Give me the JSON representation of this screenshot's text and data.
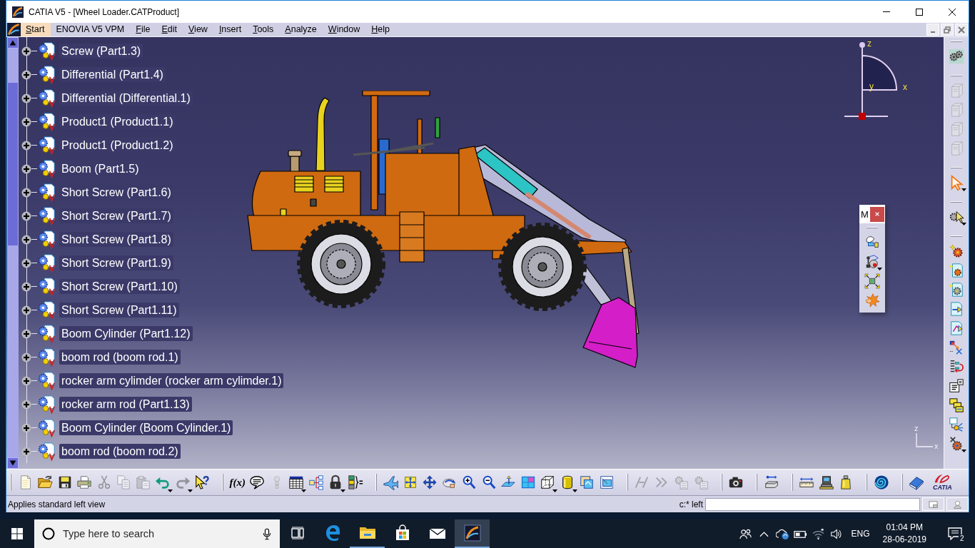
{
  "window": {
    "title": "CATIA V5 - [Wheel Loader.CATProduct]"
  },
  "menu_bar": {
    "items": [
      {
        "label": "Start",
        "highlighted": true,
        "mnemonic": true
      },
      {
        "label": "ENOVIA V5 VPM",
        "highlighted": false,
        "mnemonic": false
      },
      {
        "label": "File",
        "highlighted": false,
        "mnemonic": true
      },
      {
        "label": "Edit",
        "highlighted": false,
        "mnemonic": true
      },
      {
        "label": "View",
        "highlighted": false,
        "mnemonic": true
      },
      {
        "label": "Insert",
        "highlighted": false,
        "mnemonic": true
      },
      {
        "label": "Tools",
        "highlighted": false,
        "mnemonic": true
      },
      {
        "label": "Analyze",
        "highlighted": false,
        "mnemonic": true
      },
      {
        "label": "Window",
        "highlighted": false,
        "mnemonic": true
      },
      {
        "label": "Help",
        "highlighted": false,
        "mnemonic": true
      }
    ]
  },
  "tree": {
    "items": [
      {
        "label": "Screw (Part1.3)",
        "expanded": false
      },
      {
        "label": "Differential (Part1.4)",
        "expanded": false
      },
      {
        "label": "Differential (Differential.1)",
        "expanded": false
      },
      {
        "label": "Product1 (Product1.1)",
        "expanded": false
      },
      {
        "label": "Product1 (Product1.2)",
        "expanded": false
      },
      {
        "label": "Boom (Part1.5)",
        "expanded": false
      },
      {
        "label": "Short Screw (Part1.6)",
        "expanded": false
      },
      {
        "label": "Short Screw (Part1.7)",
        "expanded": false
      },
      {
        "label": "Short Screw (Part1.8)",
        "expanded": false
      },
      {
        "label": "Short Screw (Part1.9)",
        "expanded": false
      },
      {
        "label": "Short Screw (Part1.10)",
        "expanded": false
      },
      {
        "label": "Short Screw (Part1.11)",
        "expanded": false
      },
      {
        "label": "Boom Cylinder (Part1.12)",
        "expanded": false
      },
      {
        "label": "boom rod (boom rod.1)",
        "expanded": false
      },
      {
        "label": "rocker arm cylimder (rocker arm cylimder.1)",
        "expanded": false
      },
      {
        "label": "rocker arm rod (Part1.13)",
        "expanded": false
      },
      {
        "label": "Boom Cylinder (Boom Cylinder.1)",
        "expanded": false
      },
      {
        "label": "boom rod (boom rod.2)",
        "expanded": false
      }
    ]
  },
  "compass": {
    "z_axis": "z",
    "x_axis": "x",
    "y_axis": "y"
  },
  "axis_triad": {
    "z_axis": "z",
    "x_axis": "x"
  },
  "floating_toolbar": {
    "title": "M",
    "buttons": [
      {
        "kind": "manipulate",
        "disabled": false
      },
      {
        "kind": "joystick",
        "disabled": false
      },
      {
        "kind": "explode",
        "disabled": false
      },
      {
        "kind": "clash",
        "disabled": false
      }
    ]
  },
  "right_toolbar": {
    "groups": [
      {
        "buttons": [
          {
            "kind": "gears",
            "disabled": false
          }
        ]
      },
      {
        "buttons": [
          {
            "kind": "part",
            "disabled": true
          },
          {
            "kind": "part",
            "disabled": true
          },
          {
            "kind": "part",
            "disabled": true
          },
          {
            "kind": "part",
            "disabled": true
          }
        ]
      },
      {
        "buttons": [
          {
            "kind": "select",
            "disabled": false
          }
        ]
      },
      {
        "buttons": [
          {
            "kind": "gear_cursor",
            "disabled": false
          }
        ]
      },
      {
        "buttons": [
          {
            "kind": "gears_star",
            "disabled": false
          },
          {
            "kind": "gear_doc",
            "disabled": false
          },
          {
            "kind": "gear_doc_b",
            "disabled": false
          },
          {
            "kind": "doc_arrow",
            "disabled": false
          },
          {
            "kind": "doc_path",
            "disabled": false
          },
          {
            "kind": "link",
            "disabled": false
          },
          {
            "kind": "list_arrow",
            "disabled": false
          },
          {
            "kind": "numbering",
            "disabled": false
          },
          {
            "kind": "boxes",
            "disabled": false
          },
          {
            "kind": "tree_diagram",
            "disabled": false
          },
          {
            "kind": "gear_cross",
            "disabled": false
          }
        ]
      }
    ]
  },
  "bottom_toolbar": {
    "groups": [
      {
        "buttons": [
          {
            "kind": "new",
            "disabled": false
          },
          {
            "kind": "open",
            "disabled": false
          },
          {
            "kind": "save",
            "disabled": false
          },
          {
            "kind": "print",
            "disabled": false
          },
          {
            "kind": "cut",
            "disabled": true
          },
          {
            "kind": "copy",
            "disabled": true
          },
          {
            "kind": "paste_special",
            "disabled": true
          },
          {
            "kind": "undo",
            "disabled": false
          },
          {
            "kind": "redo",
            "disabled": true
          },
          {
            "kind": "whats_this",
            "disabled": false
          }
        ]
      },
      {
        "buttons": [
          {
            "kind": "formula",
            "label": "f(x)",
            "disabled": false
          },
          {
            "kind": "comment",
            "disabled": false
          },
          {
            "kind": "bulb",
            "disabled": true
          },
          {
            "kind": "table",
            "disabled": false
          },
          {
            "kind": "hierarchy",
            "disabled": false
          },
          {
            "kind": "lock",
            "disabled": false
          },
          {
            "kind": "parameters",
            "disabled": false
          }
        ]
      },
      {
        "buttons": [
          {
            "kind": "fly",
            "disabled": false
          },
          {
            "kind": "fit_all",
            "disabled": false
          },
          {
            "kind": "pan",
            "disabled": false
          },
          {
            "kind": "rotate",
            "disabled": false
          },
          {
            "kind": "zoom_in",
            "disabled": false
          },
          {
            "kind": "zoom_out",
            "disabled": false
          },
          {
            "kind": "normal_view",
            "disabled": false
          },
          {
            "kind": "multi_view",
            "disabled": false
          },
          {
            "kind": "iso_view",
            "disabled": false
          },
          {
            "kind": "shading",
            "disabled": false
          },
          {
            "kind": "hide_show",
            "disabled": false
          },
          {
            "kind": "swap",
            "disabled": false
          }
        ]
      },
      {
        "buttons": [
          {
            "kind": "split",
            "disabled": true
          },
          {
            "kind": "chevrons",
            "disabled": true
          },
          {
            "kind": "gear_sheet",
            "disabled": true
          },
          {
            "kind": "gear_sheet",
            "disabled": true
          }
        ]
      },
      {
        "buttons": [
          {
            "kind": "camera",
            "disabled": false
          }
        ]
      },
      {
        "buttons": [
          {
            "kind": "measure",
            "disabled": false
          }
        ]
      },
      {
        "buttons": [
          {
            "kind": "ruler",
            "disabled": false
          },
          {
            "kind": "probe",
            "disabled": false
          },
          {
            "kind": "weight",
            "disabled": false
          }
        ]
      },
      {
        "buttons": [
          {
            "kind": "spiral",
            "disabled": false
          }
        ]
      },
      {
        "buttons": [
          {
            "kind": "book",
            "disabled": false
          }
        ]
      }
    ],
    "logo": "CATIA"
  },
  "status_bar": {
    "message": "Applies standard left view",
    "command_label": "c:* left"
  },
  "taskbar": {
    "search_placeholder": "Type here to search",
    "apps": [
      {
        "kind": "edge",
        "running": false,
        "active": false
      },
      {
        "kind": "explorer",
        "running": true,
        "active": false
      },
      {
        "kind": "store",
        "running": false,
        "active": false
      },
      {
        "kind": "mail",
        "running": false,
        "active": false
      },
      {
        "kind": "catia",
        "running": true,
        "active": true
      }
    ],
    "language": "ENG",
    "time": "01:04 PM",
    "date": "28-06-2019",
    "notification_count": "2"
  }
}
